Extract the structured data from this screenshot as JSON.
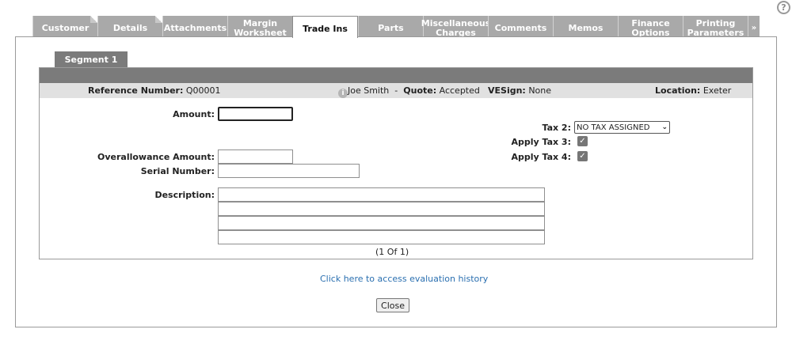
{
  "help": {
    "glyph": "?"
  },
  "tabs": [
    {
      "label": "Customer",
      "active": false
    },
    {
      "label": "Details",
      "active": false
    },
    {
      "label": "Attachments",
      "active": false
    },
    {
      "label": "Margin Worksheet",
      "active": false
    },
    {
      "label": "Trade Ins",
      "active": true
    },
    {
      "label": "Parts",
      "active": false
    },
    {
      "label": "Miscellaneous Charges",
      "active": false
    },
    {
      "label": "Comments",
      "active": false
    },
    {
      "label": "Memos",
      "active": false
    },
    {
      "label": "Finance Options",
      "active": false
    },
    {
      "label": "Printing Parameters",
      "active": false
    }
  ],
  "tabs_more": "»",
  "segment": {
    "tab_label": "Segment 1"
  },
  "info": {
    "reference_label": "Reference Number:",
    "reference_value": "Q00001",
    "info_glyph": "i",
    "user": "Joe Smith",
    "separator": "-",
    "quote_label": "Quote:",
    "quote_value": "Accepted",
    "vesign_label": "VESign:",
    "vesign_value": "None",
    "location_label": "Location:",
    "location_value": "Exeter"
  },
  "form": {
    "amount_label": "Amount:",
    "amount_value": "",
    "overallowance_label": "Overallowance Amount:",
    "overallowance_value": "",
    "serial_label": "Serial Number:",
    "serial_value": "",
    "description_label": "Description:",
    "description_lines": [
      "",
      "",
      "",
      ""
    ],
    "tax2_label": "Tax 2:",
    "tax2_selected": "NO TAX ASSIGNED",
    "apply_tax3_label": "Apply Tax 3:",
    "apply_tax3_checked": true,
    "apply_tax4_label": "Apply Tax 4:",
    "apply_tax4_checked": true,
    "checkmark": "✓"
  },
  "pager": "(1  Of  1)",
  "evaluation_link": "Click here to access evaluation history",
  "close_button": "Close",
  "colors": {
    "tab_bg": "#a9a9a9",
    "header_bg": "#7b7b7b",
    "info_bg": "#e1e1e1",
    "link": "#2a6fb0"
  }
}
